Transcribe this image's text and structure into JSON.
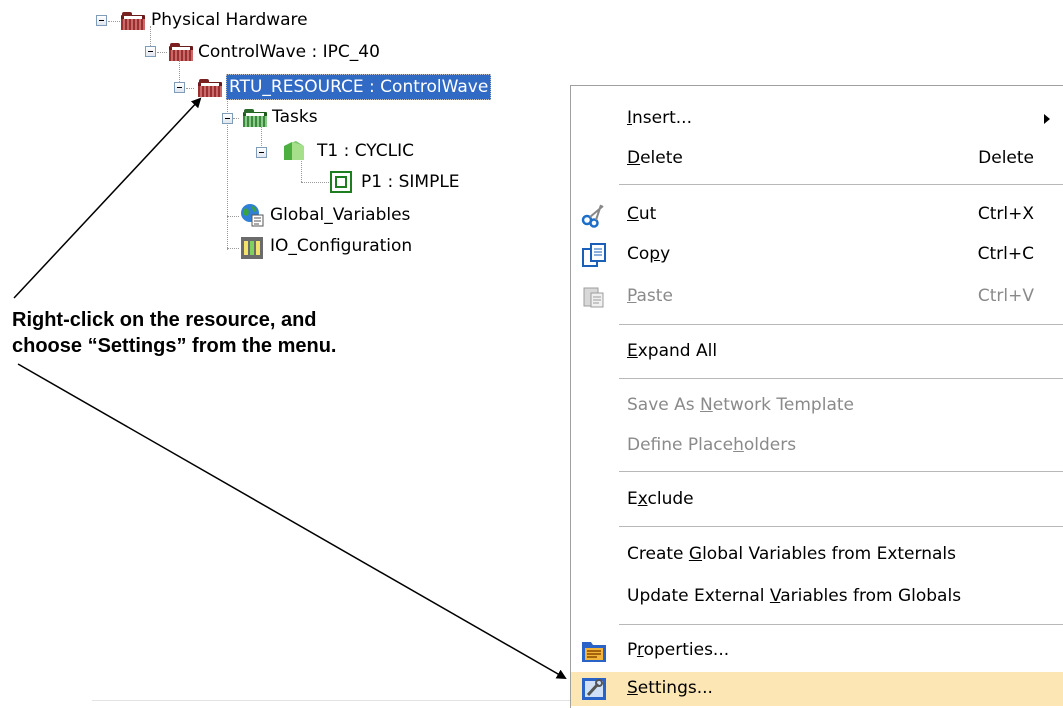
{
  "tree": {
    "items": [
      {
        "label": "Physical Hardware",
        "icon": "red-folder-icon"
      },
      {
        "label": "ControlWave : IPC_40",
        "icon": "red-folder-icon"
      },
      {
        "label": "RTU_RESOURCE : ControlWave",
        "icon": "red-folder-icon",
        "selected": true
      },
      {
        "label": "Tasks",
        "icon": "green-folder-icon"
      },
      {
        "label": "T1 : CYCLIC",
        "icon": "green-task-icon"
      },
      {
        "label": "P1 : SIMPLE",
        "icon": "program-icon"
      },
      {
        "label": "Global_Variables",
        "icon": "global-variables-icon"
      },
      {
        "label": "IO_Configuration",
        "icon": "io-configuration-icon"
      }
    ]
  },
  "context_menu": {
    "items": [
      {
        "label": "Insert...",
        "mnemonic": "I",
        "shortcut": "",
        "has_submenu": true,
        "enabled": true
      },
      {
        "label": "Delete",
        "mnemonic": "D",
        "shortcut": "Delete",
        "enabled": true
      },
      {
        "label": "Cut",
        "mnemonic": "C",
        "shortcut": "Ctrl+X",
        "icon": "scissors-icon",
        "enabled": true
      },
      {
        "label": "Copy",
        "mnemonic": "p",
        "shortcut": "Ctrl+C",
        "icon": "copy-icon",
        "enabled": true
      },
      {
        "label": "Paste",
        "mnemonic": "P",
        "shortcut": "Ctrl+V",
        "icon": "paste-icon",
        "enabled": false
      },
      {
        "label": "Expand All",
        "mnemonic": "E",
        "shortcut": "",
        "enabled": true
      },
      {
        "label": "Save As Network Template",
        "mnemonic": "N",
        "shortcut": "",
        "enabled": false
      },
      {
        "label": "Define Placeholders",
        "mnemonic": "h",
        "shortcut": "",
        "enabled": false
      },
      {
        "label": "Exclude",
        "mnemonic": "x",
        "shortcut": "",
        "enabled": true
      },
      {
        "label": "Create Global Variables from Externals",
        "mnemonic": "G",
        "shortcut": "",
        "enabled": true
      },
      {
        "label": "Update External Variables from Globals",
        "mnemonic": "V",
        "shortcut": "",
        "enabled": true
      },
      {
        "label": "Properties...",
        "mnemonic": "r",
        "shortcut": "",
        "icon": "properties-icon",
        "enabled": true
      },
      {
        "label": "Settings...",
        "mnemonic": "S",
        "shortcut": "",
        "icon": "settings-icon",
        "enabled": true,
        "highlighted": true
      }
    ]
  },
  "annotation": {
    "line1": "Right-click on the resource, and",
    "line2": "choose “Settings” from the menu."
  },
  "colors": {
    "selection": "#316ac5",
    "menu_highlight": "#fbe6b4",
    "disabled_text": "#8a8a8a"
  }
}
